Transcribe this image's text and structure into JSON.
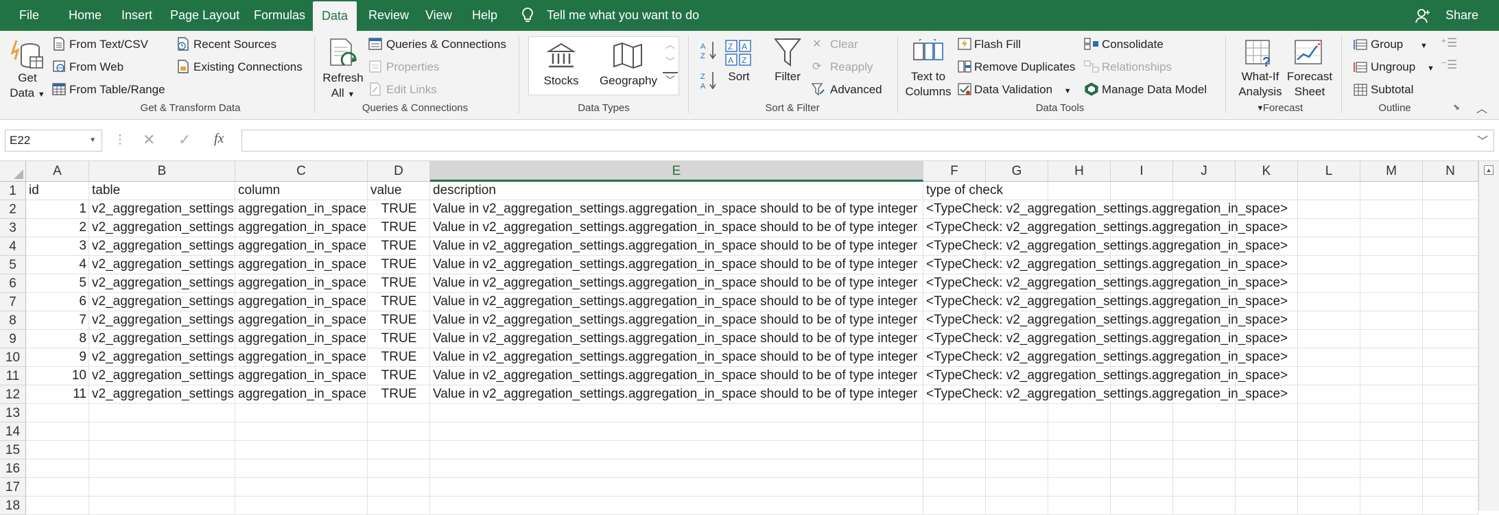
{
  "menu": {
    "tabs": [
      "File",
      "Home",
      "Insert",
      "Page Layout",
      "Formulas",
      "Data",
      "Review",
      "View",
      "Help"
    ],
    "active": "Data",
    "tell_me": "Tell me what you want to do",
    "share": "Share"
  },
  "ribbon": {
    "get_transform": {
      "get_data": "Get",
      "get_data2": "Data",
      "from_text": "From Text/CSV",
      "from_web": "From Web",
      "from_table": "From Table/Range",
      "recent_sources": "Recent Sources",
      "existing_connections": "Existing Connections",
      "label": "Get & Transform Data"
    },
    "queries": {
      "refresh": "Refresh",
      "refresh2": "All",
      "queries_connections": "Queries & Connections",
      "properties": "Properties",
      "edit_links": "Edit Links",
      "label": "Queries & Connections"
    },
    "data_types": {
      "stocks": "Stocks",
      "geography": "Geography",
      "label": "Data Types"
    },
    "sort_filter": {
      "sort": "Sort",
      "filter": "Filter",
      "clear": "Clear",
      "reapply": "Reapply",
      "advanced": "Advanced",
      "label": "Sort & Filter"
    },
    "data_tools": {
      "text_to_columns": "Text to",
      "text_to_columns2": "Columns",
      "flash_fill": "Flash Fill",
      "remove_duplicates": "Remove Duplicates",
      "data_validation": "Data Validation",
      "consolidate": "Consolidate",
      "relationships": "Relationships",
      "manage_data_model": "Manage Data Model",
      "label": "Data Tools"
    },
    "forecast": {
      "what_if": "What-If",
      "what_if2": "Analysis",
      "forecast_sheet": "Forecast",
      "forecast_sheet2": "Sheet",
      "label": "Forecast"
    },
    "outline": {
      "group": "Group",
      "ungroup": "Ungroup",
      "subtotal": "Subtotal",
      "label": "Outline"
    }
  },
  "formula_bar": {
    "name_box": "E22",
    "formula": ""
  },
  "sheet": {
    "columns": [
      "A",
      "B",
      "C",
      "D",
      "E",
      "F",
      "G",
      "H",
      "I",
      "J",
      "K",
      "L",
      "M",
      "N"
    ],
    "selected_column": "E",
    "row_numbers": [
      "1",
      "2",
      "3",
      "4",
      "5",
      "6",
      "7",
      "8",
      "9",
      "10",
      "11",
      "12",
      "13",
      "14",
      "15",
      "16",
      "17",
      "18"
    ],
    "header": [
      "id",
      "table",
      "column",
      "value",
      "description",
      "type of check"
    ],
    "rows": [
      [
        "1",
        "v2_aggregation_settings",
        "aggregation_in_space",
        "TRUE",
        "Value in v2_aggregation_settings.aggregation_in_space should to be of type integer",
        "<TypeCheck: v2_aggregation_settings.aggregation_in_space>"
      ],
      [
        "2",
        "v2_aggregation_settings",
        "aggregation_in_space",
        "TRUE",
        "Value in v2_aggregation_settings.aggregation_in_space should to be of type integer",
        "<TypeCheck: v2_aggregation_settings.aggregation_in_space>"
      ],
      [
        "3",
        "v2_aggregation_settings",
        "aggregation_in_space",
        "TRUE",
        "Value in v2_aggregation_settings.aggregation_in_space should to be of type integer",
        "<TypeCheck: v2_aggregation_settings.aggregation_in_space>"
      ],
      [
        "4",
        "v2_aggregation_settings",
        "aggregation_in_space",
        "TRUE",
        "Value in v2_aggregation_settings.aggregation_in_space should to be of type integer",
        "<TypeCheck: v2_aggregation_settings.aggregation_in_space>"
      ],
      [
        "5",
        "v2_aggregation_settings",
        "aggregation_in_space",
        "TRUE",
        "Value in v2_aggregation_settings.aggregation_in_space should to be of type integer",
        "<TypeCheck: v2_aggregation_settings.aggregation_in_space>"
      ],
      [
        "6",
        "v2_aggregation_settings",
        "aggregation_in_space",
        "TRUE",
        "Value in v2_aggregation_settings.aggregation_in_space should to be of type integer",
        "<TypeCheck: v2_aggregation_settings.aggregation_in_space>"
      ],
      [
        "7",
        "v2_aggregation_settings",
        "aggregation_in_space",
        "TRUE",
        "Value in v2_aggregation_settings.aggregation_in_space should to be of type integer",
        "<TypeCheck: v2_aggregation_settings.aggregation_in_space>"
      ],
      [
        "8",
        "v2_aggregation_settings",
        "aggregation_in_space",
        "TRUE",
        "Value in v2_aggregation_settings.aggregation_in_space should to be of type integer",
        "<TypeCheck: v2_aggregation_settings.aggregation_in_space>"
      ],
      [
        "9",
        "v2_aggregation_settings",
        "aggregation_in_space",
        "TRUE",
        "Value in v2_aggregation_settings.aggregation_in_space should to be of type integer",
        "<TypeCheck: v2_aggregation_settings.aggregation_in_space>"
      ],
      [
        "10",
        "v2_aggregation_settings",
        "aggregation_in_space",
        "TRUE",
        "Value in v2_aggregation_settings.aggregation_in_space should to be of type integer",
        "<TypeCheck: v2_aggregation_settings.aggregation_in_space>"
      ],
      [
        "11",
        "v2_aggregation_settings",
        "aggregation_in_space",
        "TRUE",
        "Value in v2_aggregation_settings.aggregation_in_space should to be of type integer",
        "<TypeCheck: v2_aggregation_settings.aggregation_in_space>"
      ]
    ]
  },
  "colors": {
    "brand": "#217346",
    "ribbon_bg": "#f3f3f3",
    "disabled": "#a6a6a6"
  }
}
